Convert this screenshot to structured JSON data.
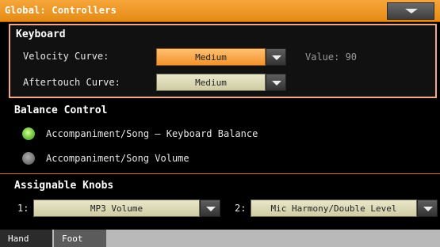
{
  "window": {
    "title": "Global: Controllers"
  },
  "keyboard": {
    "title": "Keyboard",
    "velocity_label": "Velocity Curve:",
    "velocity_value": "Medium",
    "value_readout": "Value: 90",
    "aftertouch_label": "Aftertouch Curve:",
    "aftertouch_value": "Medium"
  },
  "balance": {
    "title": "Balance Control",
    "options": [
      {
        "label": "Accompaniment/Song – Keyboard Balance",
        "selected": true
      },
      {
        "label": "Accompaniment/Song Volume",
        "selected": false
      }
    ]
  },
  "knobs": {
    "title": "Assignable Knobs",
    "knob1_index": "1:",
    "knob1_value": "MP3 Volume",
    "knob2_index": "2:",
    "knob2_value": "Mic Harmony/Double Level"
  },
  "tabs": [
    {
      "label": "Hand",
      "selected": true
    },
    {
      "label": "Foot",
      "selected": false
    }
  ],
  "colors": {
    "accent": "#f39a2a",
    "selected_radio": "#7ed04a",
    "dropdown": "#e0ddb8"
  }
}
